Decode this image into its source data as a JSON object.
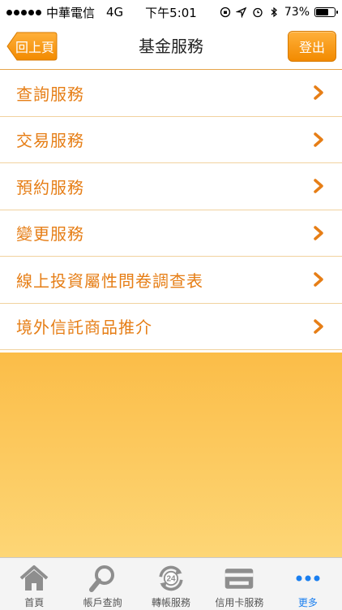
{
  "status_bar": {
    "carrier": "中華電信",
    "network": "4G",
    "time": "下午5:01",
    "battery_percent": "73%",
    "battery_level": 0.73
  },
  "nav": {
    "back_label": "回上頁",
    "title": "基金服務",
    "logout_label": "登出"
  },
  "menu": {
    "items": [
      {
        "label": "查詢服務"
      },
      {
        "label": "交易服務"
      },
      {
        "label": "預約服務"
      },
      {
        "label": "變更服務"
      },
      {
        "label": "線上投資屬性問卷調查表"
      },
      {
        "label": "境外信託商品推介"
      }
    ]
  },
  "tabbar": {
    "items": [
      {
        "label": "首頁",
        "icon": "home-icon"
      },
      {
        "label": "帳戶查詢",
        "icon": "magnifier-icon"
      },
      {
        "label": "轉帳服務",
        "icon": "transfer-24-icon"
      },
      {
        "label": "信用卡服務",
        "icon": "credit-card-icon"
      },
      {
        "label": "更多",
        "icon": "more-dots-icon"
      }
    ],
    "active_index": 4
  },
  "colors": {
    "accent": "#e67e16",
    "button_orange": "#f28a00",
    "background_top": "#fbbd48",
    "background_bottom": "#fdd676",
    "tab_active": "#1a7ff0"
  }
}
